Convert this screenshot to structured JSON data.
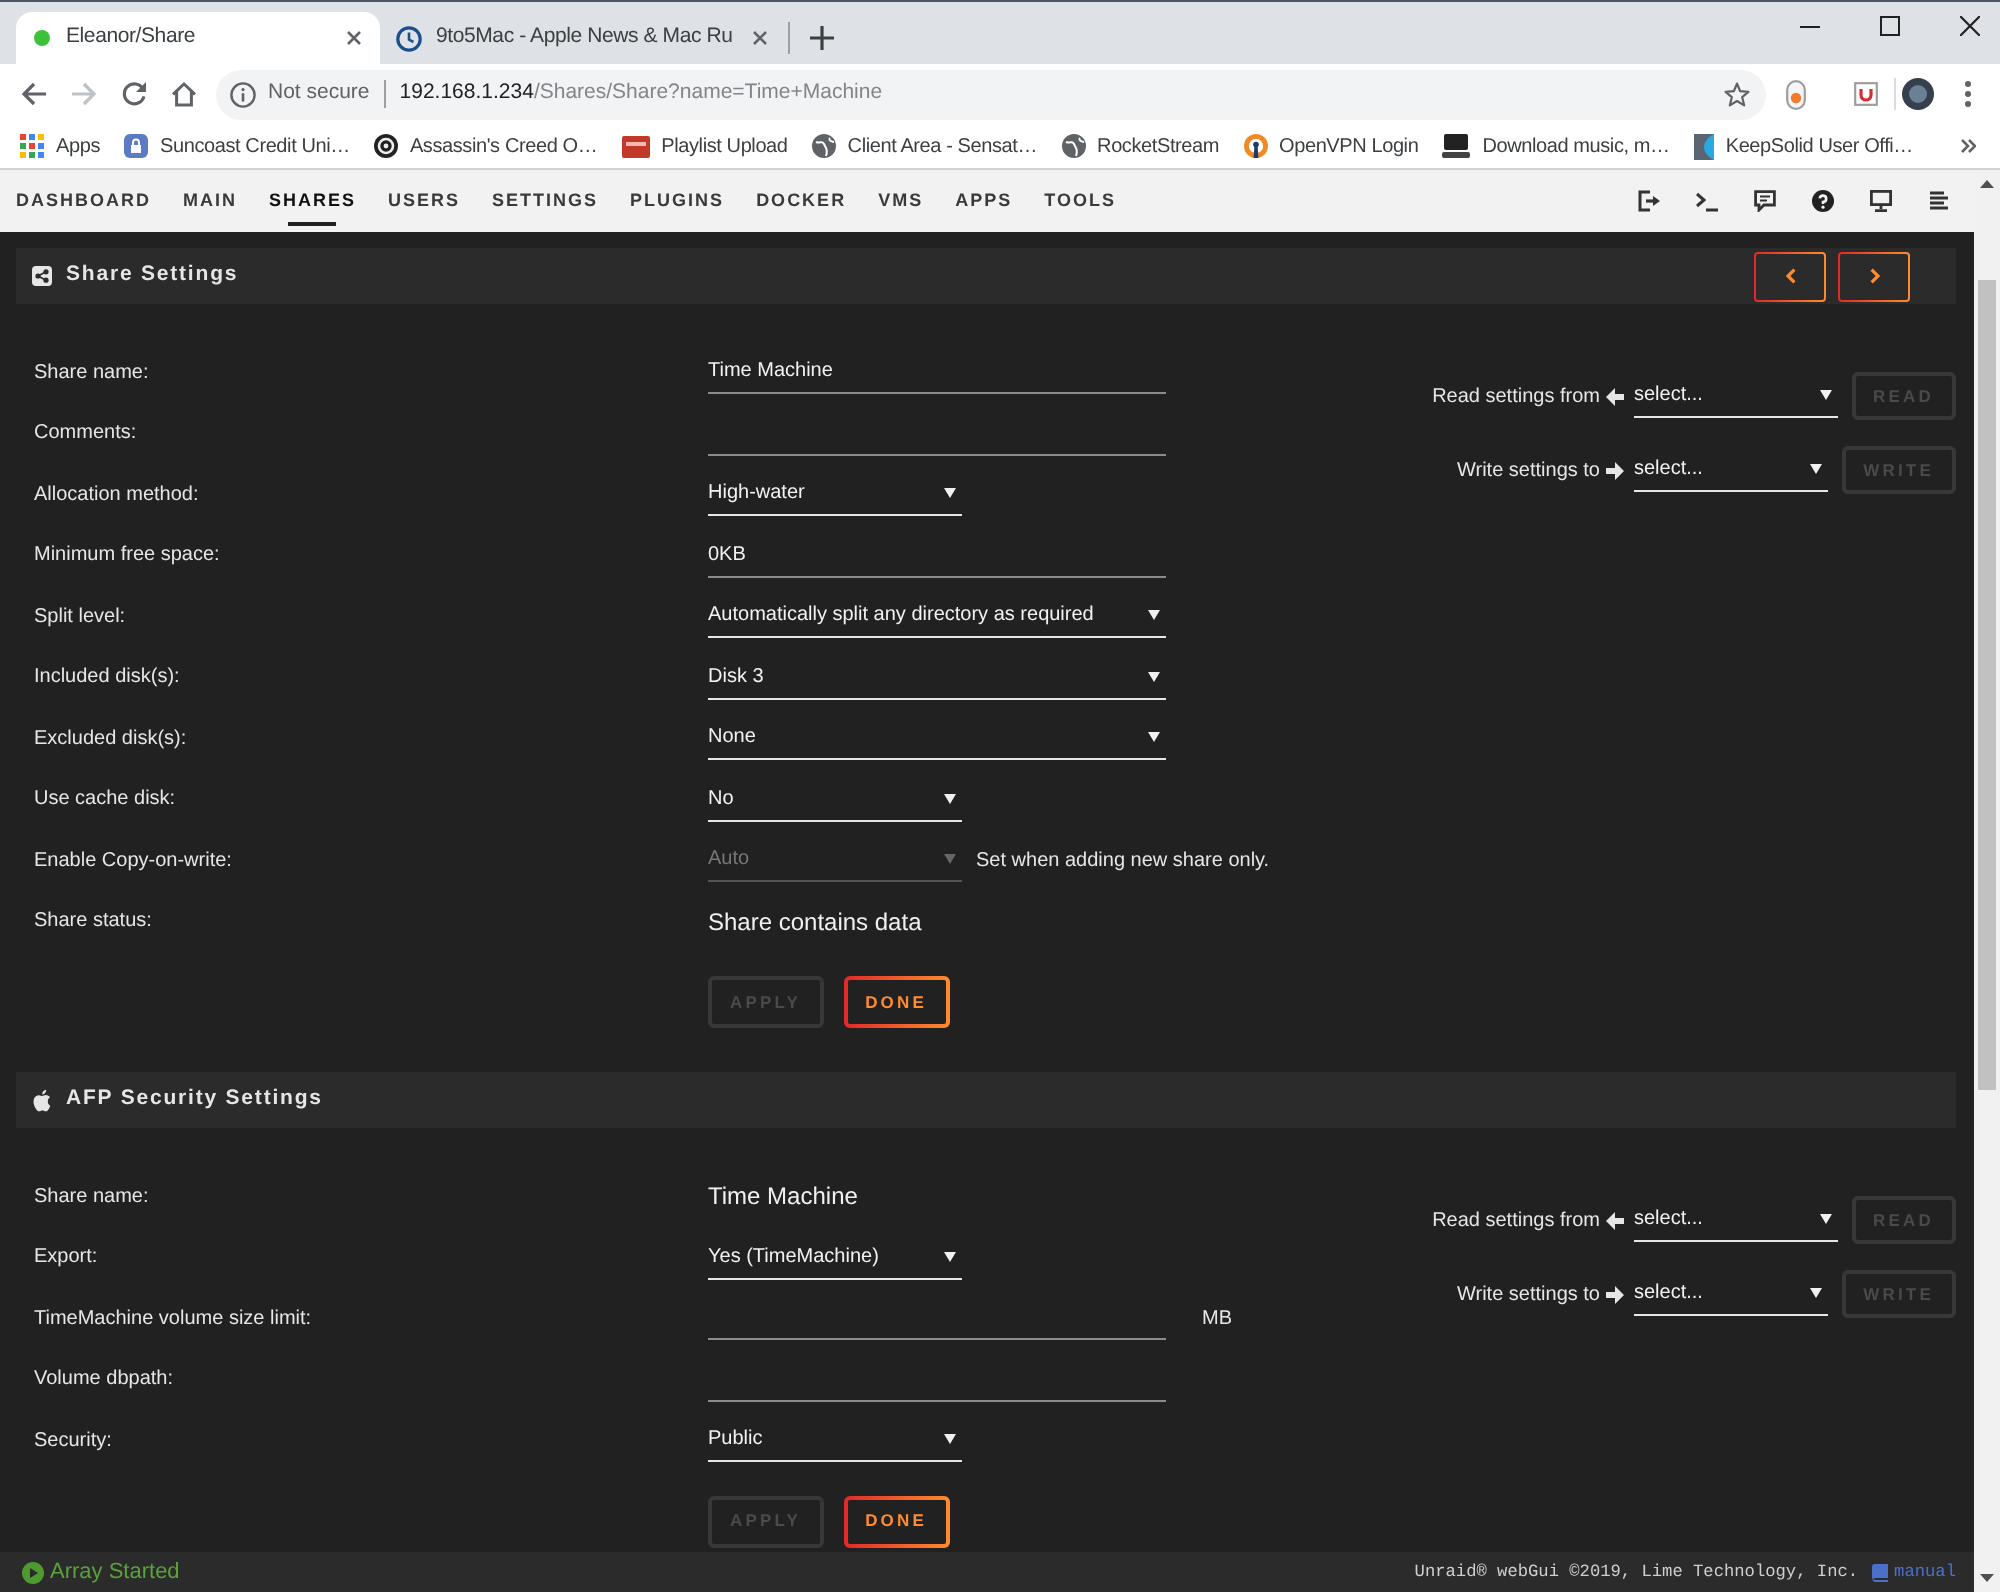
{
  "browser": {
    "tabs": [
      {
        "title": "Eleanor/Share",
        "selected": true
      },
      {
        "title": "9to5Mac - Apple News & Mac Ru",
        "selected": false
      }
    ],
    "address_bar": {
      "security": "Not secure",
      "host": "192.168.1.234",
      "path": "/Shares/Share?name=Time+Machine"
    },
    "bookmarks": [
      "Apps",
      "Suncoast Credit Uni…",
      "Assassin's Creed O…",
      "Playlist Upload",
      "Client Area - Sensat…",
      "RocketStream",
      "OpenVPN Login",
      "Download music, m…",
      "KeepSolid User Offi…"
    ]
  },
  "nav": {
    "items": [
      {
        "label": "DASHBOARD",
        "selected": false
      },
      {
        "label": "MAIN",
        "selected": false
      },
      {
        "label": "SHARES",
        "selected": true
      },
      {
        "label": "USERS",
        "selected": false
      },
      {
        "label": "SETTINGS",
        "selected": false
      },
      {
        "label": "PLUGINS",
        "selected": false
      },
      {
        "label": "DOCKER",
        "selected": false
      },
      {
        "label": "VMS",
        "selected": false
      },
      {
        "label": "APPS",
        "selected": false
      },
      {
        "label": "TOOLS",
        "selected": false
      }
    ]
  },
  "sections": [
    {
      "title": "Share Settings",
      "pager": true,
      "rows": [
        {
          "label": "Share name:",
          "kind": "input",
          "value": "Time Machine",
          "disabled": false
        },
        {
          "label": "Comments:",
          "kind": "input",
          "disabled": false
        },
        {
          "label": "Allocation method:",
          "kind": "select",
          "value": "High-water",
          "disabled": false
        },
        {
          "label": "Minimum free space:",
          "kind": "input",
          "value": "0KB",
          "disabled": false
        },
        {
          "label": "Split level:",
          "kind": "wide-select",
          "value": "Automatically split any directory as required",
          "disabled": false
        },
        {
          "label": "Included disk(s):",
          "kind": "wide-select",
          "value": "Disk 3",
          "disabled": false
        },
        {
          "label": "Excluded disk(s):",
          "kind": "wide-select",
          "value": "None",
          "disabled": false
        },
        {
          "label": "Use cache disk:",
          "kind": "select",
          "value": "No",
          "disabled": false
        },
        {
          "label": "Enable Copy-on-write:",
          "kind": "select",
          "value": "Auto",
          "disabled": true,
          "note": "Set when adding new share only."
        },
        {
          "label": "Share status:",
          "kind": "text",
          "value": "Share contains data",
          "disabled": false
        }
      ],
      "buttons": [
        {
          "label": "APPLY",
          "disabled": true
        },
        {
          "label": "DONE",
          "disabled": false
        }
      ],
      "transfer": [
        {
          "kind": "read",
          "label": "Read settings from",
          "select": "select...",
          "button": {
            "label": "READ",
            "disabled": true
          }
        },
        {
          "kind": "write",
          "label": "Write settings to",
          "select": "select...",
          "button": {
            "label": "WRITE",
            "disabled": true
          }
        }
      ]
    },
    {
      "title": "AFP Security Settings",
      "pager": false,
      "rows": [
        {
          "label": "Share name:",
          "kind": "text",
          "value": "Time Machine",
          "disabled": false
        },
        {
          "label": "Export:",
          "kind": "select",
          "value": "Yes (TimeMachine)",
          "disabled": false
        },
        {
          "label": "TimeMachine volume size limit:",
          "kind": "input",
          "unit": "MB",
          "disabled": false
        },
        {
          "label": "Volume dbpath:",
          "kind": "input",
          "disabled": false
        },
        {
          "label": "Security:",
          "kind": "select",
          "value": "Public",
          "disabled": false
        }
      ],
      "buttons": [
        {
          "label": "APPLY",
          "disabled": true
        },
        {
          "label": "DONE",
          "disabled": false
        }
      ],
      "transfer": [
        {
          "kind": "read",
          "label": "Read settings from",
          "select": "select...",
          "button": {
            "label": "READ",
            "disabled": true
          }
        },
        {
          "kind": "write",
          "label": "Write settings to",
          "select": "select...",
          "button": {
            "label": "WRITE",
            "disabled": true
          }
        }
      ]
    }
  ],
  "status_bar": {
    "status": "Array Started",
    "copyright": "Unraid® webGui ©2019, Lime Technology, Inc.",
    "manual_link": "manual"
  }
}
